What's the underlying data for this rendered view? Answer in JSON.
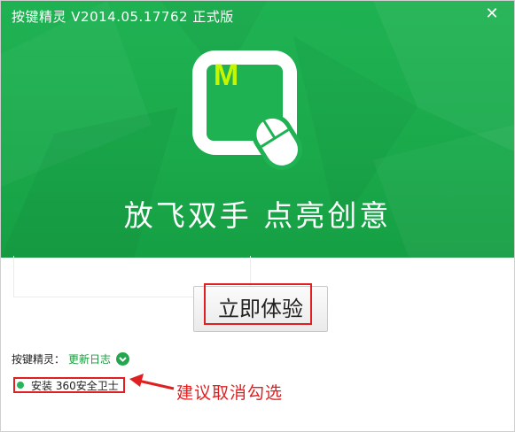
{
  "window": {
    "title": "按键精灵 V2014.05.17762 正式版"
  },
  "hero": {
    "logo_letter": "M",
    "slogan": "放飞双手  点亮创意"
  },
  "main": {
    "start_button": "立即体验"
  },
  "footer": {
    "changelog_prefix": "按键精灵：",
    "changelog_link": "更新日志",
    "install_option": "安装 360安全卫士"
  },
  "annotation": {
    "text": "建议取消勾选"
  },
  "colors": {
    "brand_green": "#1fb253",
    "accent_red": "#e02020",
    "logo_letter": "#c6f500"
  }
}
